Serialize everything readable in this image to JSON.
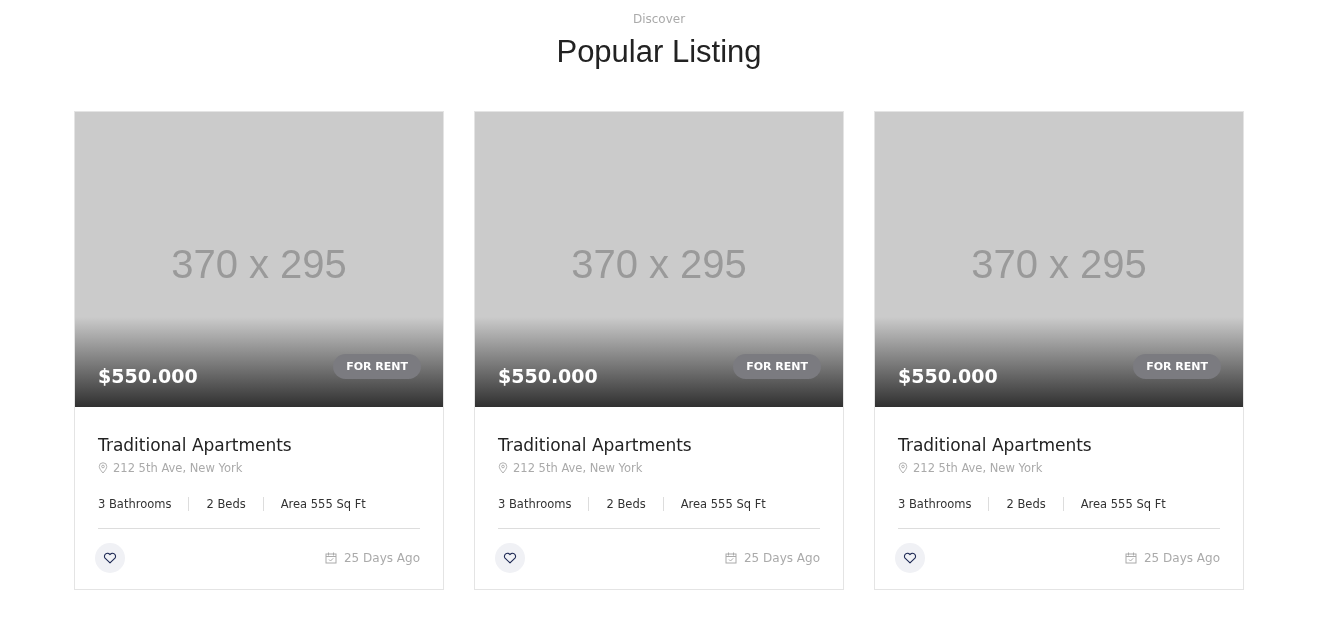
{
  "header": {
    "eyebrow": "Discover",
    "title": "Popular Listing"
  },
  "listings": [
    {
      "image_label": "370 x 295",
      "price": "$550.000",
      "tag": "FOR RENT",
      "title": "Traditional Apartments",
      "address": "212 5th Ave, New York",
      "features": [
        "3 Bathrooms",
        "2 Beds",
        "Area 555 Sq Ft"
      ],
      "posted": "25 Days Ago"
    },
    {
      "image_label": "370 x 295",
      "price": "$550.000",
      "tag": "FOR RENT",
      "title": "Traditional Apartments",
      "address": "212 5th Ave, New York",
      "features": [
        "3 Bathrooms",
        "2 Beds",
        "Area 555 Sq Ft"
      ],
      "posted": "25 Days Ago"
    },
    {
      "image_label": "370 x 295",
      "price": "$550.000",
      "tag": "FOR RENT",
      "title": "Traditional Apartments",
      "address": "212 5th Ave, New York",
      "features": [
        "3 Bathrooms",
        "2 Beds",
        "Area 555 Sq Ft"
      ],
      "posted": "25 Days Ago"
    }
  ]
}
